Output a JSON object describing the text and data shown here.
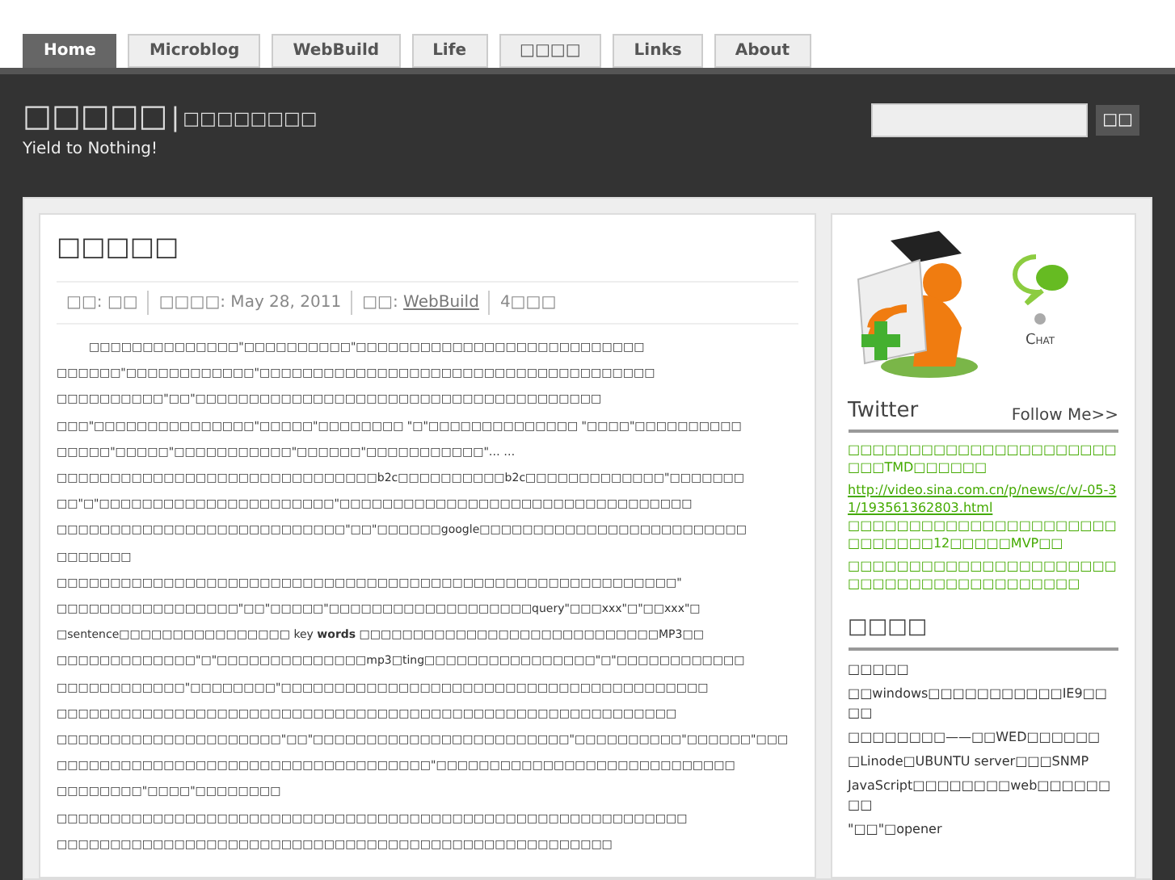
{
  "tabs": [
    {
      "label": "Home",
      "selected": true
    },
    {
      "label": "Microblog",
      "selected": false
    },
    {
      "label": "WebBuild",
      "selected": false
    },
    {
      "label": "Life",
      "selected": false
    },
    {
      "label": "□□□□",
      "selected": false
    },
    {
      "label": "Links",
      "selected": false
    },
    {
      "label": "About",
      "selected": false
    }
  ],
  "header": {
    "site_title": "□□□□□",
    "separator": "|",
    "subtitle": "□□□□□□□□",
    "tagline": "Yield to Nothing!",
    "search": {
      "button": "□□"
    }
  },
  "post": {
    "title": "□□□□□",
    "meta": [
      {
        "kind": "text",
        "text": "□□: □□"
      },
      {
        "kind": "date",
        "text": "□□□□: May 28, 2011"
      },
      {
        "kind": "category",
        "label": "□□:",
        "link": "WebBuild"
      },
      {
        "kind": "text",
        "text": "4□□□"
      }
    ],
    "lines": [
      {
        "indent": true,
        "text": "□□□□□□□□□□□□□□\"□□□□□□□□□□\"□□□□□□□□□□□□□□□□□□□□□□□□□□□"
      },
      {
        "indent": false,
        "text": "□□□□□□\"□□□□□□□□□□□□\"□□□□□□□□□□□□□□□□□□□□□□□□□□□□□□□□□□□□□"
      },
      {
        "indent": false,
        "text": "□□□□□□□□□□\"□□\"□□□□□□□□□□□□□□□□□□□□□□□□□□□□□□□□□□□□□□"
      },
      {
        "indent": false,
        "text": "□□□\"□□□□□□□□□□□□□□□\"□□□□□\"□□□□□□□□ \"□\"□□□□□□□□□□□□□□ \"□□□□\"□□□□□□□□□□"
      },
      {
        "indent": false,
        "text": "□□□□□\"□□□□□\"□□□□□□□□□□□\"□□□□□□\"□□□□□□□□□□□\"… …"
      },
      {
        "indent": false,
        "text": "□□□□□□□□□□□□□□□□□□□□□□□□□□□□□□b2c□□□□□□□□□□b2c□□□□□□□□□□□□□\"□□□□□□□"
      },
      {
        "indent": false,
        "text": "□□\"□\"□□□□□□□□□□□□□□□□□□□□□□\"□□□□□□□□□□□□□□□□□□□□□□□□□□□□□□□□□"
      },
      {
        "indent": false,
        "text": "□□□□□□□□□□□□□□□□□□□□□□□□□□□\"□□\"□□□□□□google□□□□□□□□□□□□□□□□□□□□□□□□□"
      },
      {
        "indent": false,
        "text": "□□□□□□□"
      },
      {
        "indent": false,
        "text": "□□□□□□□□□□□□□□□□□□□□□□□□□□□□□□□□□□□□□□□□□□□□□□□□□□□□□□□□□□\""
      },
      {
        "indent": false,
        "text": "□□□□□□□□□□□□□□□□□\"□□\"□□□□□\"□□□□□□□□□□□□□□□□□□□query\"□□□xxx\"□\"□□xxx\"□"
      },
      {
        "indent": false,
        "text": "□sentence□□□□□□□□□□□□□□□□ key **words** □□□□□□□□□□□□□□□□□□□□□□□□□□□□MP3□□"
      },
      {
        "indent": false,
        "text": "□□□□□□□□□□□□□\"□\"□□□□□□□□□□□□□□mp3□ting□□□□□□□□□□□□□□□□\"□\"□□□□□□□□□□□□"
      },
      {
        "indent": false,
        "text": "□□□□□□□□□□□□\"□□□□□□□□\"□□□□□□□□□□□□□□□□□□□□□□□□□□□□□□□□□□□□□□□□"
      },
      {
        "indent": false,
        "text": "□□□□□□□□□□□□□□□□□□□□□□□□□□□□□□□□□□□□□□□□□□□□□□□□□□□□□□□□□□"
      },
      {
        "indent": false,
        "text": "□□□□□□□□□□□□□□□□□□□□□\"□□\"□□□□□□□□□□□□□□□□□□□□□□□□\"□□□□□□□□□□\"□□□□□□\"□□□"
      },
      {
        "indent": false,
        "text": "□□□□□□□□□□□□□□□□□□□□□□□□□□□□□□□□□□□\"□□□□□□□□□□□□□□□□□□□□□□□□□□□□"
      },
      {
        "indent": false,
        "text": "□□□□□□□□\"□□□□\"□□□□□□□□"
      },
      {
        "indent": false,
        "text": "□□□□□□□□□□□□□□□□□□□□□□□□□□□□□□□□□□□□□□□□□□□□□□□□□□□□□□□□□□□"
      },
      {
        "indent": false,
        "text": "□□□□□□□□□□□□□□□□□□□□□□□□□□□□□□□□□□□□□□□□□□□□□□□□□□□□"
      }
    ]
  },
  "sidebar": {
    "chat": {
      "label": "Chat",
      "online": false
    },
    "twitter": {
      "title": "Twitter",
      "follow": "Follow Me>>",
      "tweets": [
        {
          "text": "□□□□□□□□□□□□□□□□□□□□□□□□□TMD□□□□□□"
        },
        {
          "link": "http://video.sina.com.cn/p/news/c/v/-05-31/193561362803.html",
          "text": " □□□□□□□□□□□□□□□□□□□□□□□□□□□□□12□□□□□MVP□□"
        },
        {
          "text": "□□□□□□□□□□□□□□□□□□□□□□□□□□□□□□□□□□□□□□□□□"
        }
      ]
    },
    "recent": {
      "title": "□□□□",
      "posts": [
        "□□□□□",
        "□□windows□□□□□□□□□□□IE9□□□□",
        "□□□□□□□□——□□WED□□□□□□",
        "□Linode□UBUNTU server□□□SNMP",
        "JavaScript□□□□□□□□web□□□□□□□□",
        "\"□□\"□opener"
      ]
    }
  }
}
